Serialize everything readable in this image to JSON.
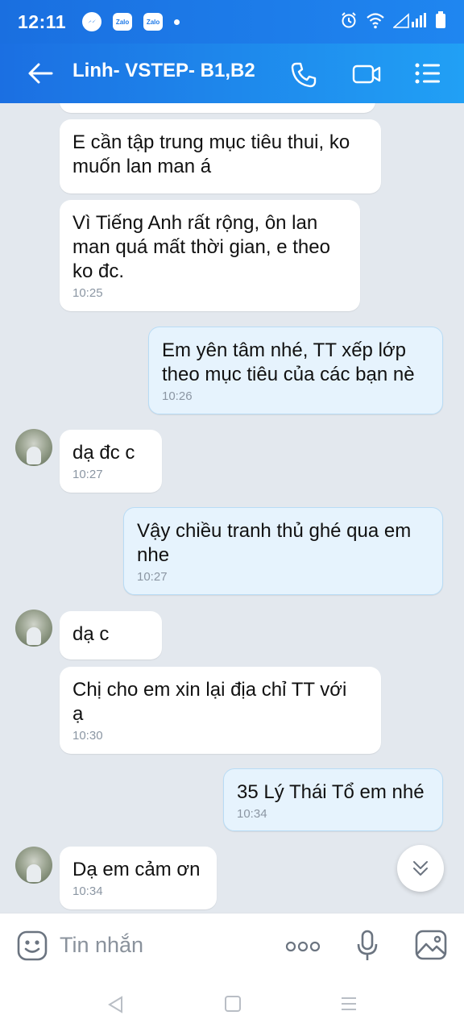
{
  "status_bar": {
    "time": "12:11",
    "zalo_label": "Zalo"
  },
  "header": {
    "title": "Linh- VSTEP- B1,B2"
  },
  "messages": [
    {
      "side": "in",
      "text": "E cần tập trung mục tiêu thui, ko\nmuốn lan man á",
      "time": ""
    },
    {
      "side": "in",
      "text": "Vì Tiếng Anh rất rộng, ôn lan\nman quá mất thời gian, e theo\nko đc.",
      "time": "10:25"
    },
    {
      "side": "out",
      "text": "Em yên tâm nhé, TT xếp lớp\ntheo mục tiêu của các bạn nè",
      "time": "10:26"
    },
    {
      "side": "in",
      "text": "dạ đc c",
      "time": "10:27",
      "avatar": true
    },
    {
      "side": "out",
      "text": "Vậy chiều tranh thủ ghé qua em\nnhe",
      "time": "10:27"
    },
    {
      "side": "in",
      "text": "dạ c",
      "time": "",
      "avatar": true
    },
    {
      "side": "in",
      "text": "Chị cho em xin lại địa chỉ TT với\nạ",
      "time": "10:30"
    },
    {
      "side": "out",
      "text": "35 Lý Thái Tổ em nhé",
      "time": "10:34"
    },
    {
      "side": "in",
      "text": "Dạ em cảm ơn",
      "time": "10:34",
      "avatar": true
    }
  ],
  "composer": {
    "placeholder": "Tin nhắn"
  },
  "colors": {
    "header_start": "#1b6fe2",
    "header_end": "#21a0f5",
    "chat_bg": "#e3e8ee",
    "outgoing_bubble": "#e6f3fd",
    "incoming_bubble": "#ffffff"
  }
}
